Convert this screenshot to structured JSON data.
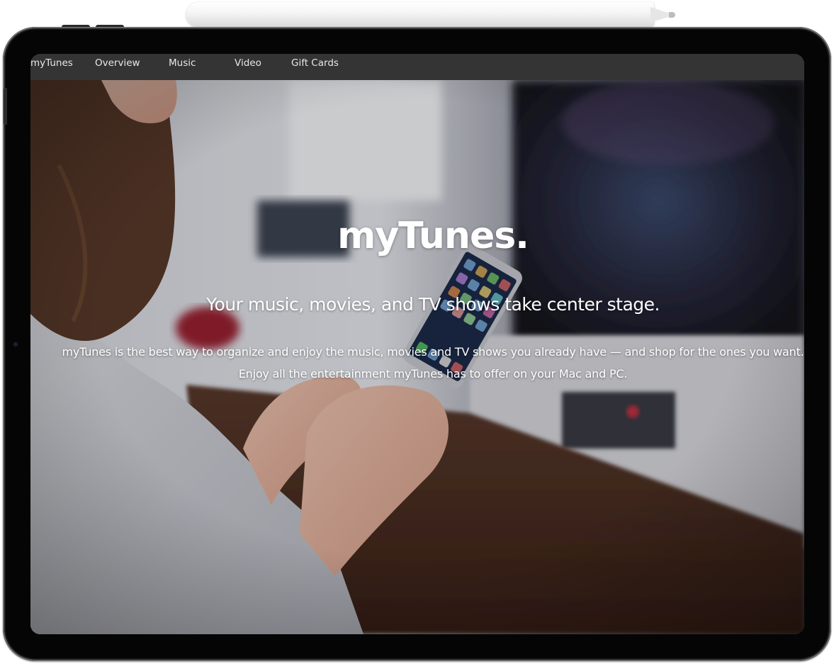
{
  "navbar": {
    "brand": "myTunes",
    "items": [
      {
        "label": "Overview"
      },
      {
        "label": "Music"
      },
      {
        "label": "Video"
      },
      {
        "label": "Gift Cards"
      }
    ]
  },
  "hero": {
    "title": "myTunes.",
    "subtitle": "Your music, movies, and TV shows take center stage.",
    "body": "myTunes is the best way to organize and enjoy the music, movies and TV shows you already have — and shop for the ones you want. Enjoy all the entertainment myTunes has to offer on your Mac and PC.",
    "background_image": "woman-holding-smartphone-photo"
  },
  "colors": {
    "navbar_bg": "#343434",
    "nav_text": "#e8e8e8",
    "device_frame": "#050505",
    "hero_text": "#ffffff"
  }
}
